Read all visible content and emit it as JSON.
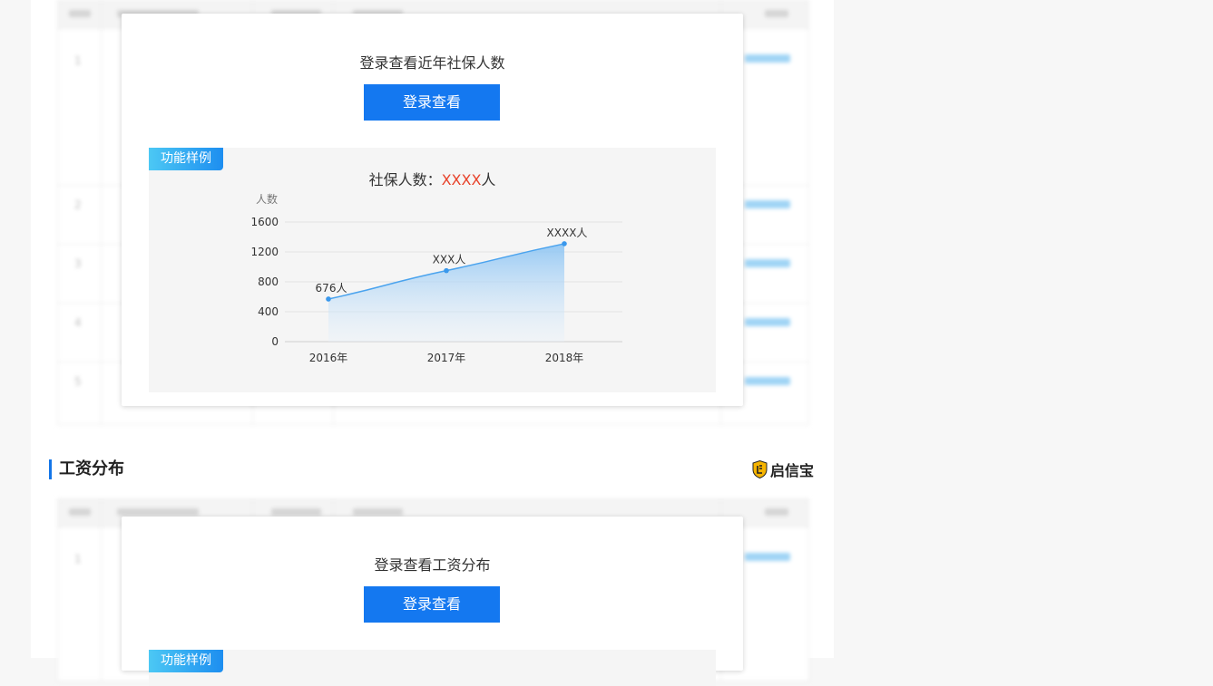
{
  "section1": {
    "prompt": "登录查看近年社保人数",
    "login_label": "登录查看",
    "sample_tag": "功能样例",
    "chart_title_prefix": "社保人数：",
    "chart_title_value": "XXXX",
    "chart_title_suffix": "人"
  },
  "section2": {
    "heading": "工资分布",
    "brand": "启信宝",
    "prompt": "登录查看工资分布",
    "login_label": "登录查看",
    "sample_tag": "功能样例"
  },
  "bg_rows": [
    "1",
    "2",
    "3",
    "4",
    "5"
  ],
  "colors": {
    "accent": "#1478f0",
    "highlight": "#e8432b",
    "line": "#4aa3ee"
  },
  "chart_data": {
    "type": "area",
    "ylabel": "人数",
    "categories": [
      "2016年",
      "2017年",
      "2018年"
    ],
    "values": [
      570,
      950,
      1310
    ],
    "data_labels": [
      "676人",
      "XXX人",
      "XXXX人"
    ],
    "yticks": [
      0,
      400,
      800,
      1200,
      1600
    ],
    "ylim": [
      0,
      1600
    ],
    "grid": true
  }
}
